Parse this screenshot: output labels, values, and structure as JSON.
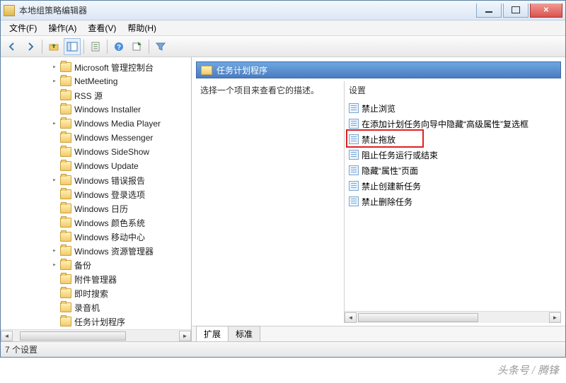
{
  "window": {
    "title": "本地组策略编辑器"
  },
  "menu": {
    "file": "文件(F)",
    "action": "操作(A)",
    "view": "查看(V)",
    "help": "帮助(H)"
  },
  "toolbar_icons": [
    "back",
    "forward",
    "up",
    "show-hide-tree",
    "properties",
    "help",
    "export",
    "filter"
  ],
  "tree": [
    {
      "label": "Microsoft 管理控制台",
      "depth": 1,
      "exp": "closed"
    },
    {
      "label": "NetMeeting",
      "depth": 1,
      "exp": "closed"
    },
    {
      "label": "RSS 源",
      "depth": 1,
      "exp": "none"
    },
    {
      "label": "Windows Installer",
      "depth": 1,
      "exp": "none"
    },
    {
      "label": "Windows Media Player",
      "depth": 1,
      "exp": "closed"
    },
    {
      "label": "Windows Messenger",
      "depth": 1,
      "exp": "none"
    },
    {
      "label": "Windows SideShow",
      "depth": 1,
      "exp": "none"
    },
    {
      "label": "Windows Update",
      "depth": 1,
      "exp": "none"
    },
    {
      "label": "Windows 错误报告",
      "depth": 1,
      "exp": "closed"
    },
    {
      "label": "Windows 登录选项",
      "depth": 1,
      "exp": "none"
    },
    {
      "label": "Windows 日历",
      "depth": 1,
      "exp": "none"
    },
    {
      "label": "Windows 颜色系统",
      "depth": 1,
      "exp": "none"
    },
    {
      "label": "Windows 移动中心",
      "depth": 1,
      "exp": "none"
    },
    {
      "label": "Windows 资源管理器",
      "depth": 1,
      "exp": "closed"
    },
    {
      "label": "备份",
      "depth": 1,
      "exp": "closed"
    },
    {
      "label": "附件管理器",
      "depth": 1,
      "exp": "none"
    },
    {
      "label": "即时搜索",
      "depth": 1,
      "exp": "none"
    },
    {
      "label": "录音机",
      "depth": 1,
      "exp": "none"
    },
    {
      "label": "任务计划程序",
      "depth": 1,
      "exp": "none"
    }
  ],
  "header": {
    "title": "任务计划程序"
  },
  "description_prompt": "选择一个项目来查看它的描述。",
  "settings_col": "设置",
  "settings": [
    "禁止浏览",
    "在添加计划任务向导中隐藏“高级属性”复选框",
    "禁止拖放",
    "阻止任务运行或结束",
    "隐藏“属性”页面",
    "禁止创建新任务",
    "禁止删除任务"
  ],
  "highlighted_setting_index": 2,
  "tabs": {
    "extended": "扩展",
    "standard": "标准"
  },
  "status": "7 个设置",
  "watermark": {
    "left": "头条号",
    "right": "腾锋"
  }
}
